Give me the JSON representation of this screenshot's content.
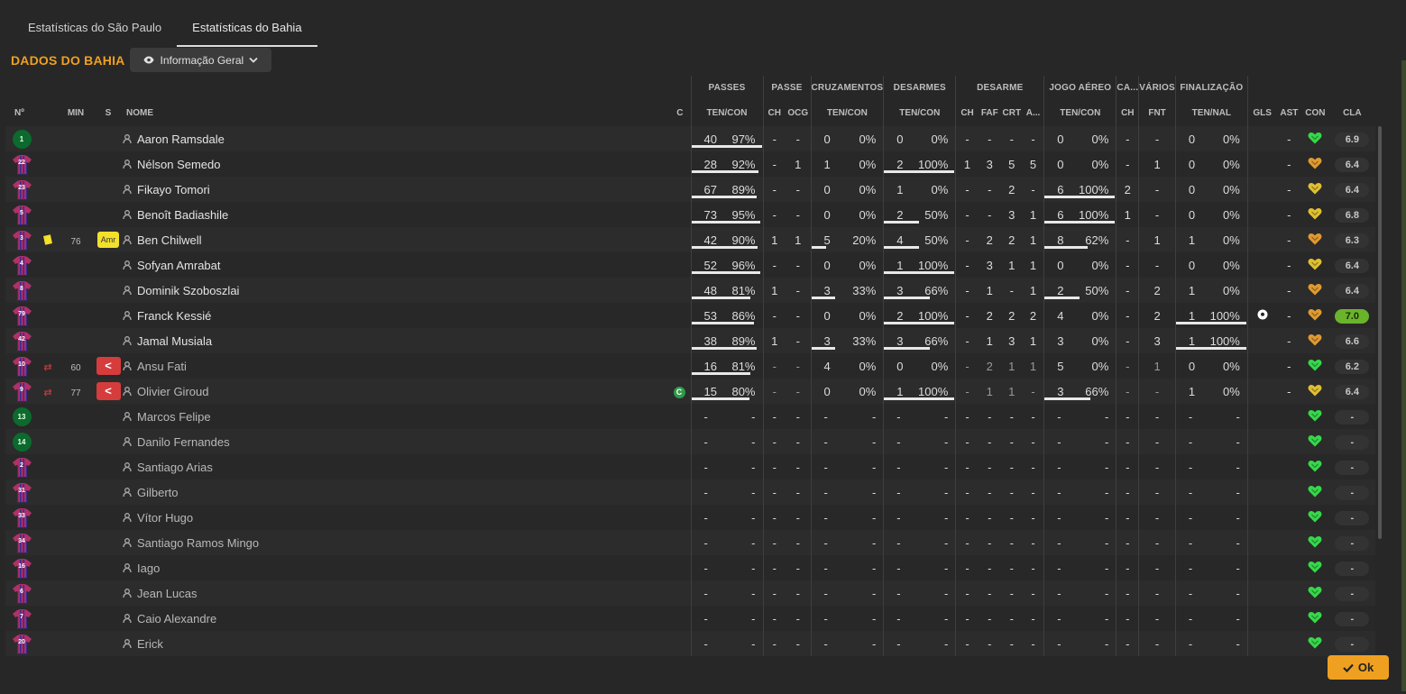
{
  "tabs": [
    {
      "label": "Estatísticas do São Paulo",
      "active": false
    },
    {
      "label": "Estatísticas do Bahia",
      "active": true
    }
  ],
  "team_title": "DADOS DO BAHIA",
  "view_dropdown": "Informação Geral",
  "ok_label": "Ok",
  "group_headers": {
    "passes": "PASSES",
    "passe": "PASSE",
    "cruzamentos": "CRUZAMENTOS",
    "desarmes": "DESARMES",
    "desarme": "DESARME",
    "jogo_aereo": "JOGO AÉREO",
    "ca": "CA...",
    "varios": "VÁRIOS",
    "finalizacao": "FINALIZAÇÃO"
  },
  "columns": {
    "num": "Nº",
    "min": "MIN",
    "s": "S",
    "nome": "NOME",
    "c": "C",
    "passes": "TEN/CON",
    "passe_ch": "CH",
    "passe_ocg": "OCG",
    "cruz": "TEN/CON",
    "des": "TEN/CON",
    "d_ch": "CH",
    "d_faf": "FAF",
    "d_crt": "CRT",
    "d_a": "A...",
    "aereo": "TEN/CON",
    "ca_ch": "CH",
    "fnt": "FNT",
    "fin": "TEN/NAL",
    "gls": "GLS",
    "ast": "AST",
    "con": "CON",
    "cla": "CLA"
  },
  "colors": {
    "accent": "#f0a020",
    "heart_green": "#36d84a",
    "heart_yellow": "#e0c030",
    "heart_orange": "#e09a30",
    "rating_top": "#6ab42c"
  },
  "players": [
    {
      "num": "1",
      "kit": "gk",
      "min": "",
      "card": false,
      "s": "",
      "sub": false,
      "name": "Aaron Ramsdale",
      "cap": false,
      "pass": [
        "40",
        "97%"
      ],
      "pass_fill": 1,
      "pch": "-",
      "pocg": "-",
      "cruz": [
        "0",
        "0%"
      ],
      "cruz_fill": 0,
      "des": [
        "0",
        "0%"
      ],
      "des_fill": 0,
      "dch": "-",
      "faf": "-",
      "crt": "-",
      "da": "-",
      "aer": [
        "0",
        "0%"
      ],
      "aer_fill": 0,
      "cach": "-",
      "fnt": "-",
      "fin": [
        "0",
        "0%"
      ],
      "fin_fill": 0,
      "gls": "",
      "ast": "-",
      "heart": "green",
      "rating": "6.9"
    },
    {
      "num": "22",
      "kit": "out",
      "min": "",
      "card": false,
      "s": "",
      "sub": false,
      "name": "Nélson Semedo",
      "cap": false,
      "pass": [
        "28",
        "92%"
      ],
      "pass_fill": 0.95,
      "pch": "-",
      "pocg": "1",
      "cruz": [
        "1",
        "0%"
      ],
      "cruz_fill": 0,
      "des": [
        "2",
        "100%"
      ],
      "des_fill": 1,
      "dch": "1",
      "faf": "3",
      "crt": "5",
      "da": "5",
      "aer": [
        "0",
        "0%"
      ],
      "aer_fill": 0,
      "cach": "-",
      "fnt": "1",
      "fin": [
        "0",
        "0%"
      ],
      "fin_fill": 0,
      "gls": "",
      "ast": "-",
      "heart": "orange",
      "rating": "6.4"
    },
    {
      "num": "23",
      "kit": "out",
      "min": "",
      "card": false,
      "s": "",
      "sub": false,
      "name": "Fikayo Tomori",
      "cap": false,
      "pass": [
        "67",
        "89%"
      ],
      "pass_fill": 0.92,
      "pch": "-",
      "pocg": "-",
      "cruz": [
        "0",
        "0%"
      ],
      "cruz_fill": 0,
      "des": [
        "1",
        "0%"
      ],
      "des_fill": 0,
      "dch": "-",
      "faf": "-",
      "crt": "2",
      "da": "-",
      "aer": [
        "6",
        "100%"
      ],
      "aer_fill": 1,
      "cach": "2",
      "fnt": "-",
      "fin": [
        "0",
        "0%"
      ],
      "fin_fill": 0,
      "gls": "",
      "ast": "-",
      "heart": "yellow",
      "rating": "6.4"
    },
    {
      "num": "5",
      "kit": "out",
      "min": "",
      "card": false,
      "s": "",
      "sub": false,
      "name": "Benoît Badiashile",
      "cap": false,
      "pass": [
        "73",
        "95%"
      ],
      "pass_fill": 0.98,
      "pch": "-",
      "pocg": "-",
      "cruz": [
        "0",
        "0%"
      ],
      "cruz_fill": 0,
      "des": [
        "2",
        "50%"
      ],
      "des_fill": 0.5,
      "dch": "-",
      "faf": "-",
      "crt": "3",
      "da": "1",
      "aer": [
        "6",
        "100%"
      ],
      "aer_fill": 1,
      "cach": "1",
      "fnt": "-",
      "fin": [
        "0",
        "0%"
      ],
      "fin_fill": 0,
      "gls": "",
      "ast": "-",
      "heart": "yellow",
      "rating": "6.8"
    },
    {
      "num": "3",
      "kit": "out",
      "min": "76",
      "card": true,
      "s": "Amr",
      "sub": false,
      "name": "Ben Chilwell",
      "cap": false,
      "pass": [
        "42",
        "90%"
      ],
      "pass_fill": 0.93,
      "pch": "1",
      "pocg": "1",
      "cruz": [
        "5",
        "20%"
      ],
      "cruz_fill": 0.2,
      "des": [
        "4",
        "50%"
      ],
      "des_fill": 0.5,
      "dch": "-",
      "faf": "2",
      "crt": "2",
      "da": "1",
      "aer": [
        "8",
        "62%"
      ],
      "aer_fill": 0.62,
      "cach": "-",
      "fnt": "1",
      "fin": [
        "1",
        "0%"
      ],
      "fin_fill": 0,
      "gls": "",
      "ast": "-",
      "heart": "orange",
      "rating": "6.3"
    },
    {
      "num": "4",
      "kit": "out",
      "min": "",
      "card": false,
      "s": "",
      "sub": false,
      "name": "Sofyan Amrabat",
      "cap": false,
      "pass": [
        "52",
        "96%"
      ],
      "pass_fill": 0.98,
      "pch": "-",
      "pocg": "-",
      "cruz": [
        "0",
        "0%"
      ],
      "cruz_fill": 0,
      "des": [
        "1",
        "100%"
      ],
      "des_fill": 1,
      "dch": "-",
      "faf": "3",
      "crt": "1",
      "da": "1",
      "aer": [
        "0",
        "0%"
      ],
      "aer_fill": 0,
      "cach": "-",
      "fnt": "-",
      "fin": [
        "0",
        "0%"
      ],
      "fin_fill": 0,
      "gls": "",
      "ast": "-",
      "heart": "yellow",
      "rating": "6.4"
    },
    {
      "num": "8",
      "kit": "out",
      "min": "",
      "card": false,
      "s": "",
      "sub": false,
      "name": "Dominik Szoboszlai",
      "cap": false,
      "pass": [
        "48",
        "81%"
      ],
      "pass_fill": 0.83,
      "pch": "1",
      "pocg": "-",
      "cruz": [
        "3",
        "33%"
      ],
      "cruz_fill": 0.33,
      "des": [
        "3",
        "66%"
      ],
      "des_fill": 0.66,
      "dch": "-",
      "faf": "1",
      "crt": "-",
      "da": "1",
      "aer": [
        "2",
        "50%"
      ],
      "aer_fill": 0.5,
      "cach": "-",
      "fnt": "2",
      "fin": [
        "1",
        "0%"
      ],
      "fin_fill": 0,
      "gls": "",
      "ast": "-",
      "heart": "orange",
      "rating": "6.4"
    },
    {
      "num": "79",
      "kit": "out",
      "min": "",
      "card": false,
      "s": "",
      "sub": false,
      "name": "Franck Kessié",
      "cap": false,
      "pass": [
        "53",
        "86%"
      ],
      "pass_fill": 0.88,
      "pch": "-",
      "pocg": "-",
      "cruz": [
        "0",
        "0%"
      ],
      "cruz_fill": 0,
      "des": [
        "2",
        "100%"
      ],
      "des_fill": 1,
      "dch": "-",
      "faf": "2",
      "crt": "2",
      "da": "2",
      "aer": [
        "4",
        "0%"
      ],
      "aer_fill": 0,
      "cach": "-",
      "fnt": "2",
      "fin": [
        "1",
        "100%"
      ],
      "fin_fill": 1,
      "gls": "ball",
      "ast": "-",
      "heart": "orange",
      "rating": "7.0",
      "top": true
    },
    {
      "num": "42",
      "kit": "out",
      "min": "",
      "card": false,
      "s": "",
      "sub": false,
      "name": "Jamal Musiala",
      "cap": false,
      "pass": [
        "38",
        "89%"
      ],
      "pass_fill": 0.92,
      "pch": "1",
      "pocg": "-",
      "cruz": [
        "3",
        "33%"
      ],
      "cruz_fill": 0.33,
      "des": [
        "3",
        "66%"
      ],
      "des_fill": 0.66,
      "dch": "-",
      "faf": "1",
      "crt": "3",
      "da": "1",
      "aer": [
        "3",
        "0%"
      ],
      "aer_fill": 0,
      "cach": "-",
      "fnt": "3",
      "fin": [
        "1",
        "100%"
      ],
      "fin_fill": 1,
      "gls": "",
      "ast": "-",
      "heart": "orange",
      "rating": "6.6"
    },
    {
      "num": "10",
      "kit": "out",
      "min": "60",
      "card": false,
      "s": "",
      "sub": true,
      "name": "Ansu Fati",
      "cap": false,
      "pass": [
        "16",
        "81%"
      ],
      "pass_fill": 0.83,
      "pch": "-",
      "pocg": "-",
      "cruz": [
        "4",
        "0%"
      ],
      "cruz_fill": 0,
      "des": [
        "0",
        "0%"
      ],
      "des_fill": 0,
      "dch": "-",
      "faf": "2",
      "crt": "1",
      "da": "1",
      "aer": [
        "5",
        "0%"
      ],
      "aer_fill": 0,
      "cach": "-",
      "fnt": "1",
      "fin": [
        "0",
        "0%"
      ],
      "fin_fill": 0,
      "gls": "",
      "ast": "-",
      "heart": "green",
      "rating": "6.2"
    },
    {
      "num": "9",
      "kit": "out",
      "min": "77",
      "card": false,
      "s": "",
      "sub": true,
      "name": "Olivier Giroud",
      "cap": true,
      "cap_label": "C",
      "pass": [
        "15",
        "80%"
      ],
      "pass_fill": 0.82,
      "pch": "-",
      "pocg": "-",
      "cruz": [
        "0",
        "0%"
      ],
      "cruz_fill": 0,
      "des": [
        "1",
        "100%"
      ],
      "des_fill": 1,
      "dch": "-",
      "faf": "1",
      "crt": "1",
      "da": "-",
      "aer": [
        "3",
        "66%"
      ],
      "aer_fill": 0.66,
      "cach": "-",
      "fnt": "-",
      "fin": [
        "1",
        "0%"
      ],
      "fin_fill": 0,
      "gls": "",
      "ast": "-",
      "heart": "yellow",
      "rating": "6.4"
    },
    {
      "num": "13",
      "kit": "gk",
      "name": "Marcos Felipe",
      "bench": true,
      "rating": "-",
      "heart": "green"
    },
    {
      "num": "14",
      "kit": "gk",
      "name": "Danilo Fernandes",
      "bench": true,
      "rating": "-",
      "heart": "green"
    },
    {
      "num": "2",
      "kit": "out",
      "name": "Santiago Arias",
      "bench": true,
      "rating": "-",
      "heart": "green"
    },
    {
      "num": "31",
      "kit": "out",
      "name": "Gilberto",
      "bench": true,
      "rating": "-",
      "heart": "green"
    },
    {
      "num": "33",
      "kit": "out",
      "name": "Vítor Hugo",
      "bench": true,
      "rating": "-",
      "heart": "green"
    },
    {
      "num": "34",
      "kit": "out",
      "name": "Santiago Ramos Mingo",
      "bench": true,
      "rating": "-",
      "heart": "green"
    },
    {
      "num": "16",
      "kit": "out",
      "name": "Iago",
      "bench": true,
      "rating": "-",
      "heart": "green"
    },
    {
      "num": "6",
      "kit": "out",
      "name": "Jean Lucas",
      "bench": true,
      "rating": "-",
      "heart": "green"
    },
    {
      "num": "7",
      "kit": "out",
      "name": "Caio Alexandre",
      "bench": true,
      "rating": "-",
      "heart": "green"
    },
    {
      "num": "20",
      "kit": "out",
      "name": "Erick",
      "bench": true,
      "rating": "-",
      "heart": "green"
    }
  ]
}
